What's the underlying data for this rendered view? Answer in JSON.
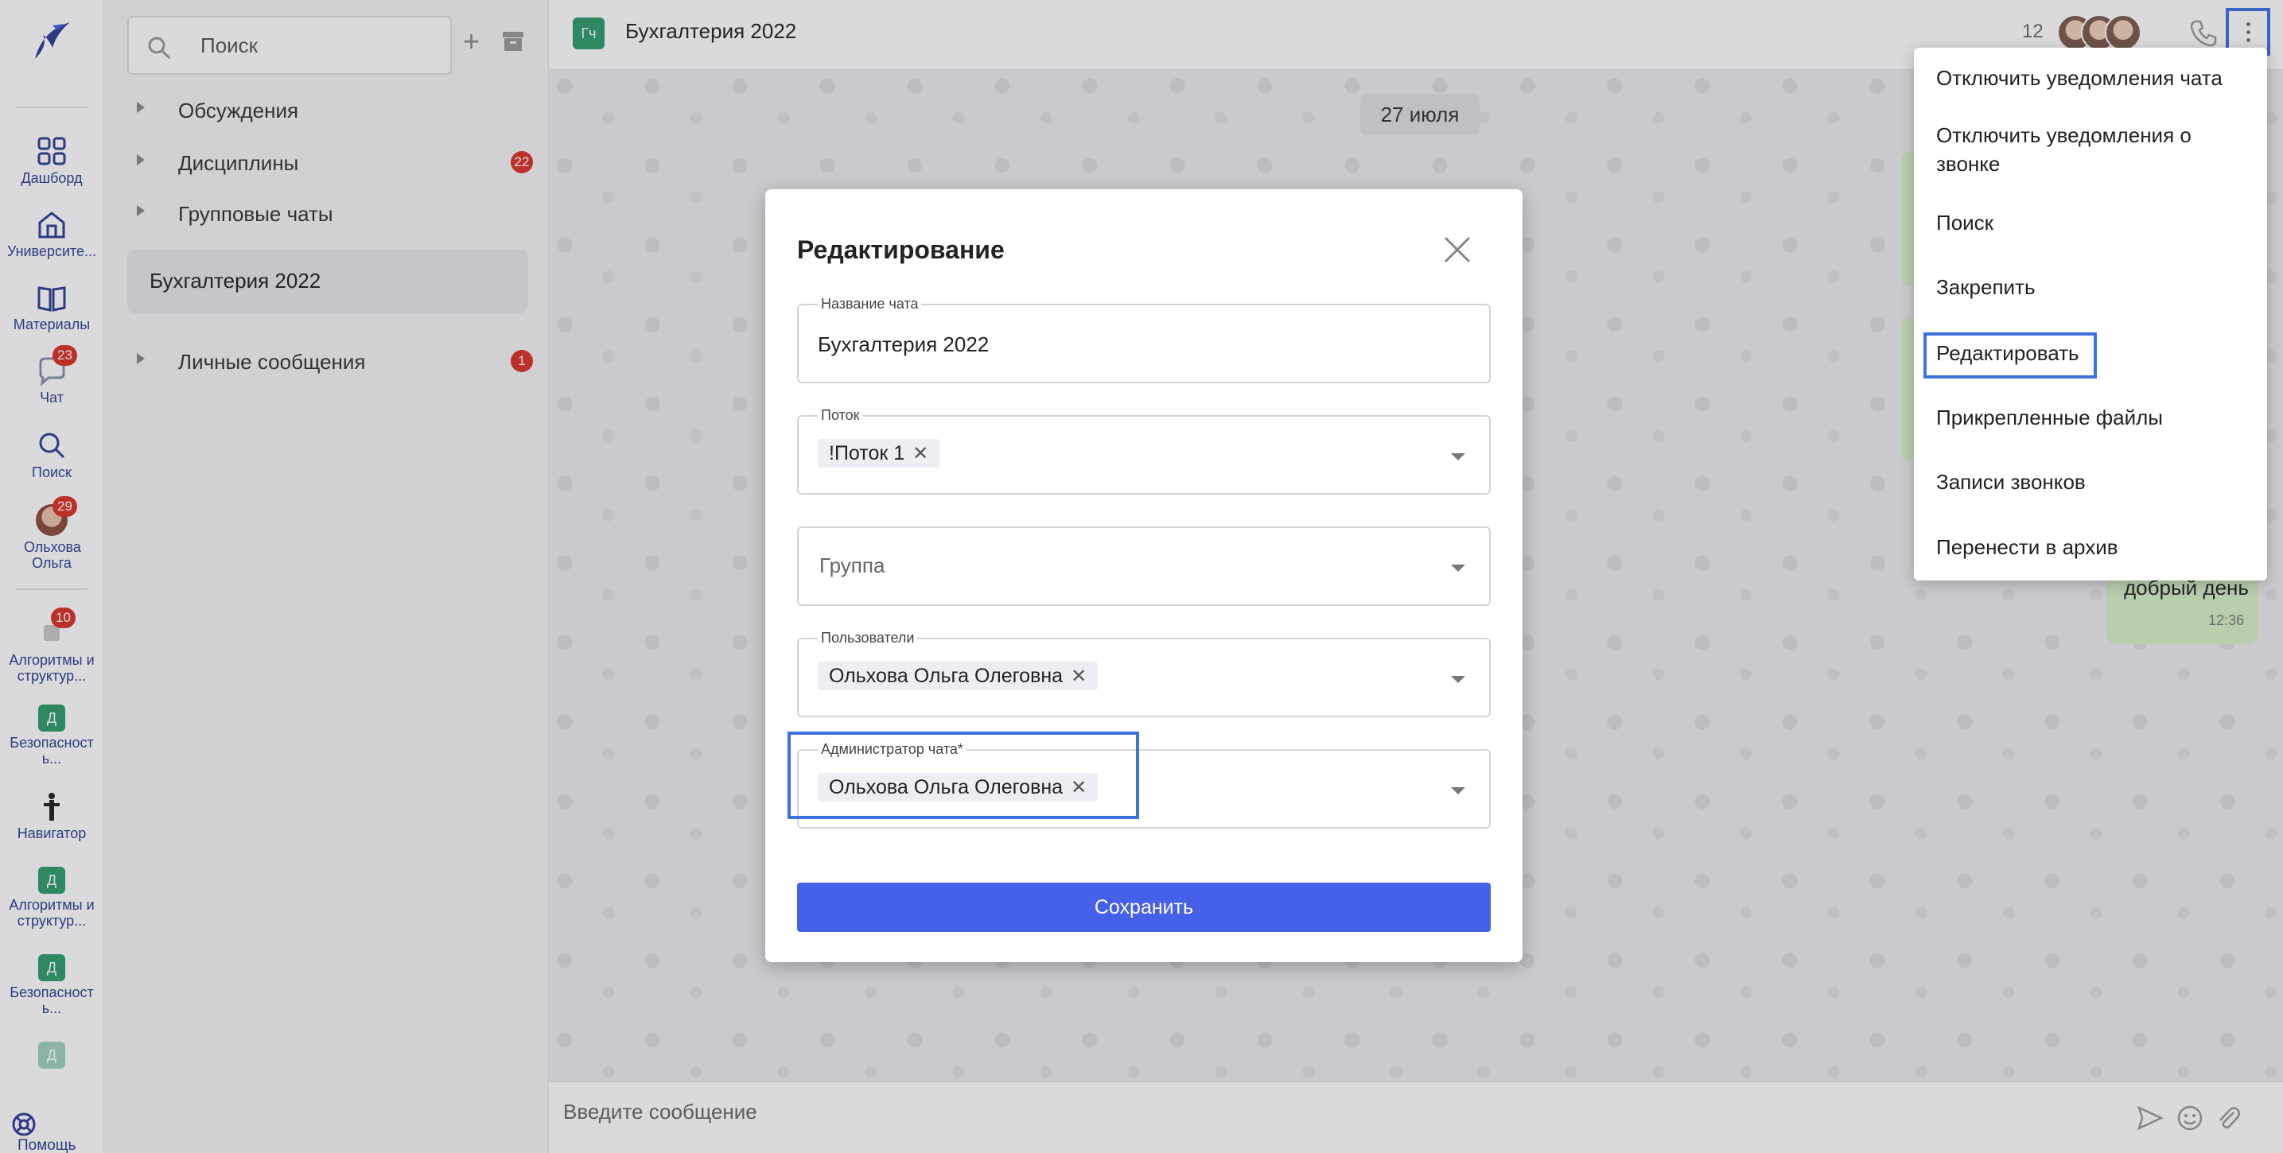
{
  "rail": {
    "items": [
      {
        "label": "Дашборд",
        "icon": "dashboard-grid-icon"
      },
      {
        "label": "Университе...",
        "icon": "university-icon"
      },
      {
        "label": "Материалы",
        "icon": "book-icon"
      },
      {
        "label": "Чат",
        "icon": "chat-bubble-icon",
        "badge": "23"
      },
      {
        "label": "Поиск",
        "icon": "search-icon"
      },
      {
        "label": "Ольхова Ольга",
        "icon": "user-avatar",
        "badge": "29"
      },
      {
        "label": "Алгоритмы и структур...",
        "icon": "course-icon",
        "badge": "10"
      },
      {
        "label": "Безопасност ь...",
        "icon": "course-letter",
        "letter": "Д"
      },
      {
        "label": "Навигатор",
        "icon": "navigator-icon"
      },
      {
        "label": "Алгоритмы и структур...",
        "icon": "course-letter",
        "letter": "Д"
      },
      {
        "label": "Безопасност ь...",
        "icon": "course-letter",
        "letter": "Д"
      },
      {
        "letter": "Д"
      }
    ],
    "help_label": "Помощь"
  },
  "chatlist": {
    "search_placeholder": "Поиск",
    "groups": [
      {
        "label": "Обсуждения"
      },
      {
        "label": "Дисциплины",
        "badge": "22"
      },
      {
        "label": "Групповые чаты"
      }
    ],
    "active_chat": "Бухгалтерия 2022",
    "personal": {
      "label": "Личные сообщения",
      "badge": "1"
    }
  },
  "header": {
    "chat_icon_text": "Гч",
    "title": "Бухгалтерия 2022",
    "participants_count": "12"
  },
  "chat": {
    "date_label": "27 июля",
    "bubble_text": "добрый день",
    "bubble_time": "12:36",
    "composer_placeholder": "Введите сообщение"
  },
  "menu": {
    "items": [
      "Отключить уведомления чата",
      "Отключить уведомления о звонке",
      "Поиск",
      "Закрепить",
      "Редактировать",
      "Прикрепленные файлы",
      "Записи звонков",
      "Перенести в архив"
    ]
  },
  "modal": {
    "title": "Редактирование",
    "fields": {
      "chat_name": {
        "label": "Название чата",
        "value": "Бухгалтерия 2022"
      },
      "stream": {
        "label": "Поток",
        "chip": "!Поток 1"
      },
      "group": {
        "placeholder": "Группа"
      },
      "users": {
        "label": "Пользователи",
        "chip": "Ольхова Ольга Олеговна"
      },
      "admin": {
        "label": "Администратор чата*",
        "chip": "Ольхова Ольга Олеговна"
      }
    },
    "chip_remove": "✕",
    "save_label": "Сохранить"
  },
  "colors": {
    "accent": "#4561ea",
    "highlight": "#3b72e0",
    "badge": "#d93025",
    "chat_icon": "#2e9b6a"
  }
}
